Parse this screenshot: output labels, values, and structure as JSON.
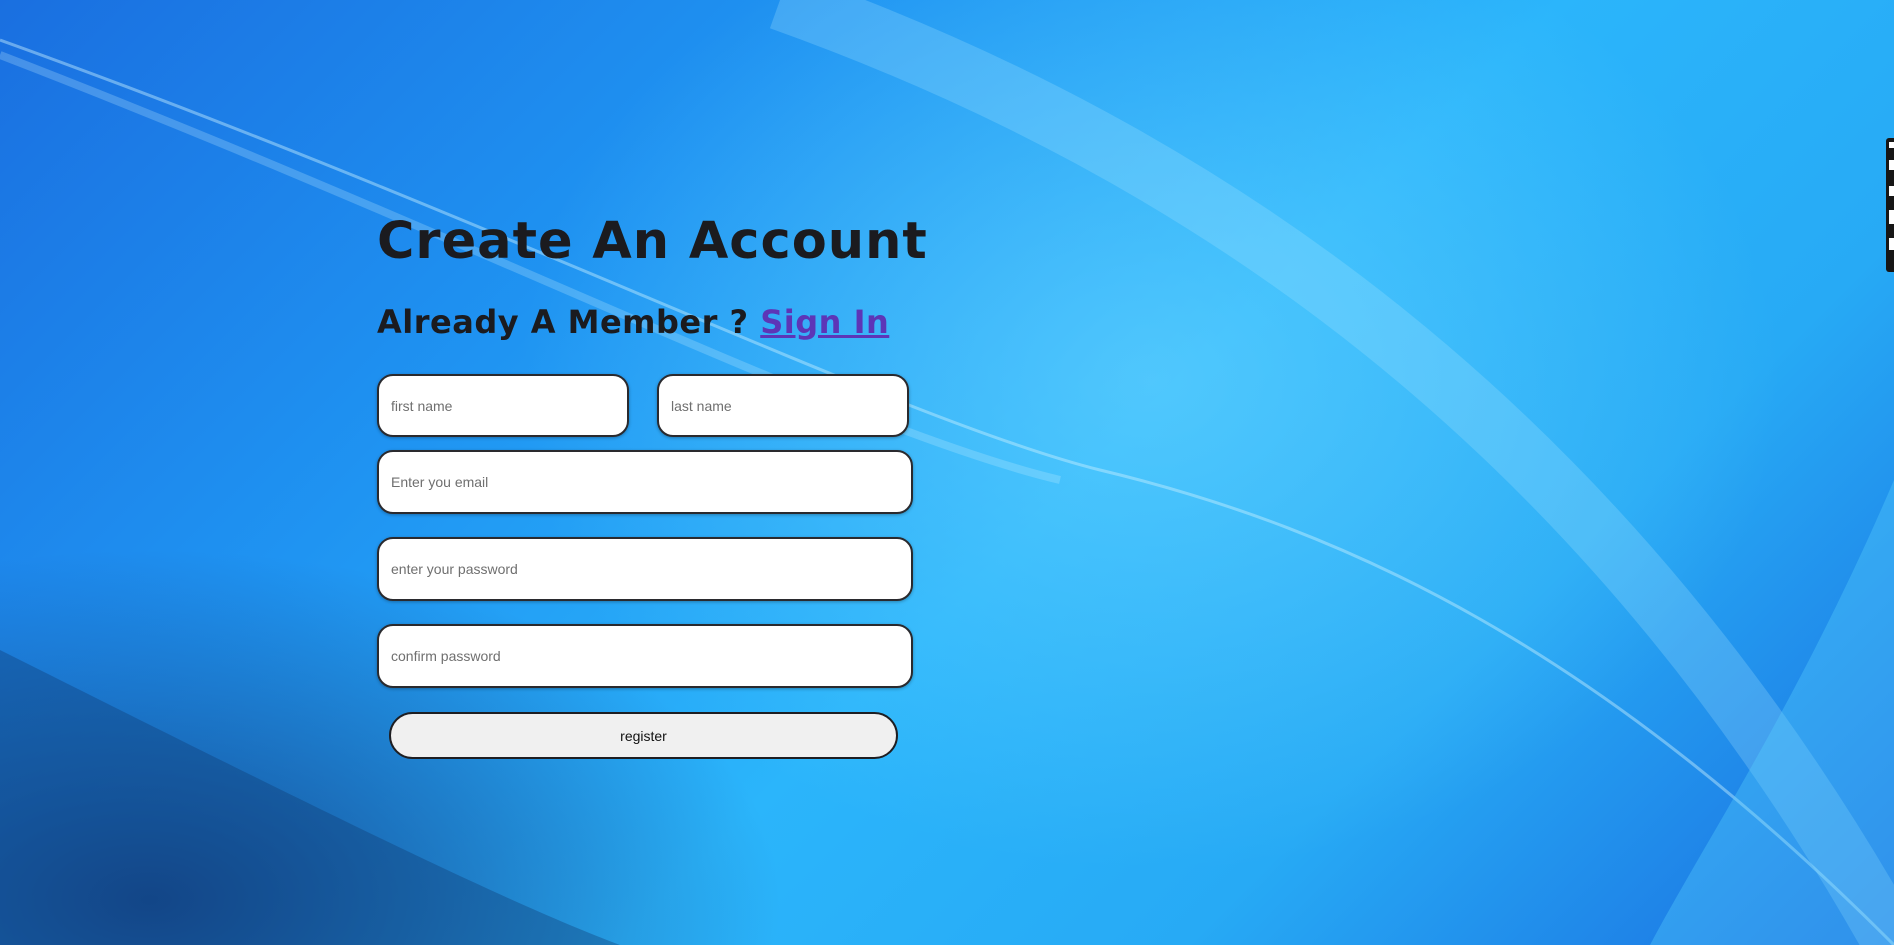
{
  "form": {
    "title": "Create An Account",
    "member_prompt": "Already A Member ?",
    "signin_label": "Sign In",
    "first_name_placeholder": "first name",
    "last_name_placeholder": "last name",
    "email_placeholder": "Enter you email",
    "password_placeholder": "enter your password",
    "confirm_placeholder": "confirm password",
    "register_label": "register"
  },
  "colors": {
    "link": "#5d35b7",
    "text": "#1b1b1f",
    "background_primary": "#1f94f2",
    "button_bg": "#f0f0f0"
  },
  "edge_toolbar": {
    "icons": [
      "settings-icon",
      "square-icon",
      "square-icon",
      "document-icon",
      "gear-icon"
    ]
  }
}
